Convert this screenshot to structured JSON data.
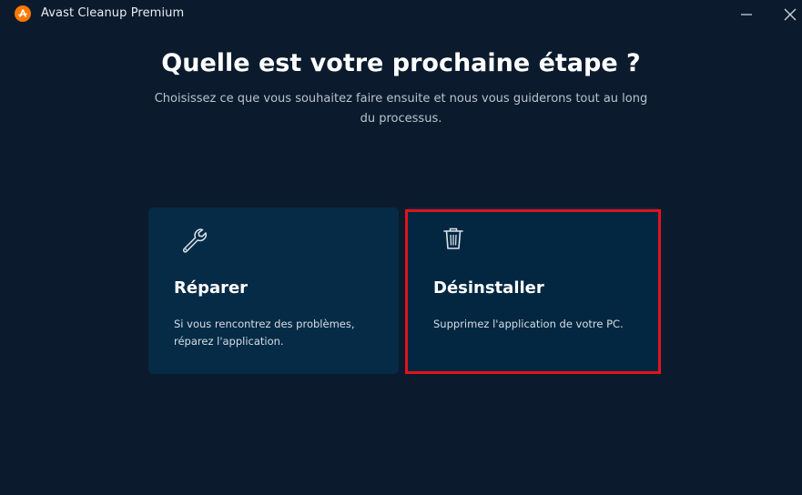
{
  "window": {
    "title": "Avast Cleanup Premium",
    "minimize_icon": "minimize-icon",
    "close_icon": "close-icon"
  },
  "main": {
    "headline": "Quelle est votre prochaine étape ?",
    "subtitle": "Choisissez ce que vous souhaitez faire ensuite et nous vous guiderons tout au long du processus."
  },
  "options": [
    {
      "icon": "wrench-icon",
      "title": "Réparer",
      "description": "Si vous rencontrez des problèmes, réparez l'application."
    },
    {
      "icon": "trash-icon",
      "title": "Désinstaller",
      "description": "Supprimez l'application de votre PC."
    }
  ],
  "colors": {
    "background": "#0b1b2d",
    "card": "#052a45",
    "brand": "#ff7800",
    "highlight": "#e0141b"
  }
}
